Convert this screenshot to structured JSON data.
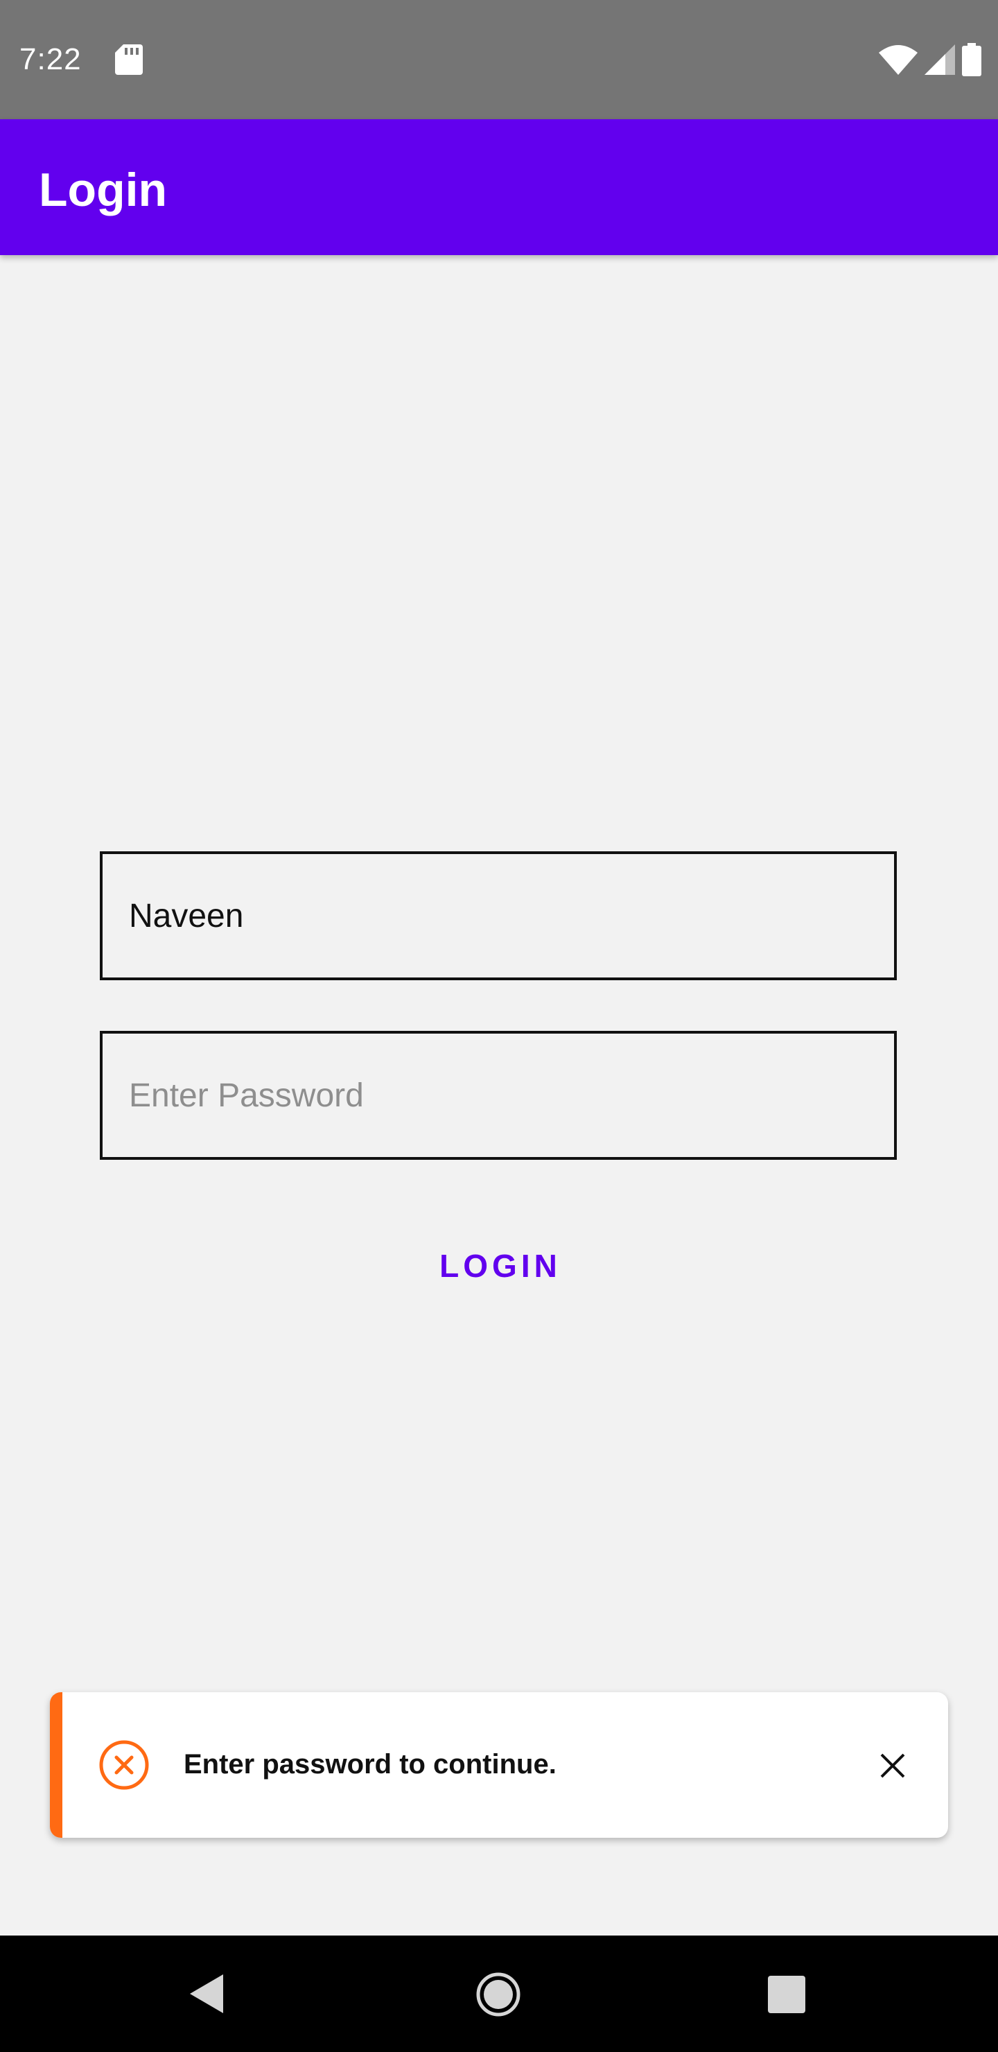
{
  "status_bar": {
    "time": "7:22",
    "icons": [
      "sd-card-icon",
      "wifi-icon",
      "signal-icon",
      "battery-icon"
    ]
  },
  "app_bar": {
    "title": "Login"
  },
  "form": {
    "username_value": "Naveen",
    "password_placeholder": "Enter Password",
    "login_label": "LOGIN"
  },
  "toast": {
    "message": "Enter password to continue.",
    "icon": "error-circle-icon",
    "close_icon": "close-icon"
  },
  "nav_bar": {
    "icons": [
      "back-icon",
      "home-icon",
      "recents-icon"
    ]
  },
  "colors": {
    "primary": "#6200ee",
    "status_bar": "#757575",
    "background": "#f2f2f2",
    "toast_accent": "#ff6a13",
    "nav_bar": "#000000"
  }
}
